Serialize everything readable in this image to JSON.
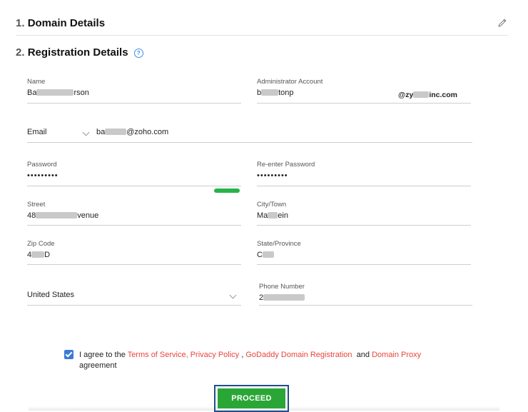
{
  "sections": {
    "domain": {
      "num": "1.",
      "title": "Domain Details"
    },
    "registration": {
      "num": "2.",
      "title": "Registration Details",
      "help": "?"
    }
  },
  "form": {
    "name": {
      "label": "Name",
      "prefix": "Ba",
      "suffix": "rson"
    },
    "admin": {
      "label": "Administrator Account",
      "prefix": "b",
      "suffix": "tonp",
      "domain_prefix": "@zy",
      "domain_suffix": "inc.com"
    },
    "email": {
      "type": "Email",
      "prefix": "ba",
      "suffix": "@zoho.com"
    },
    "password": {
      "label": "Password",
      "value": "•••••••••"
    },
    "repassword": {
      "label": "Re-enter Password",
      "value": "•••••••••"
    },
    "street": {
      "label": "Street",
      "prefix": "48",
      "suffix": "venue"
    },
    "city": {
      "label": "City/Town",
      "prefix": "Ma",
      "suffix": "ein"
    },
    "zip": {
      "label": "Zip Code",
      "prefix": "4",
      "suffix": "D"
    },
    "state": {
      "label": "State/Province",
      "prefix": "C",
      "suffix": ""
    },
    "country": {
      "value": "United States"
    },
    "phone": {
      "label": "Phone Number",
      "prefix": "2",
      "suffix": ""
    }
  },
  "agreement": {
    "checked": true,
    "pre": "I agree to the",
    "tos": "Terms of Service, Privacy Policy",
    "comma": ",",
    "godaddy": "GoDaddy Domain Registration",
    "and": "and",
    "proxy": "Domain Proxy",
    "post": "agreement"
  },
  "actions": {
    "proceed": "PROCEED"
  },
  "colors": {
    "accent": "#2aa636",
    "link": "#e8453c",
    "checkbox": "#3a7bd5",
    "strength": "#27b34a"
  }
}
